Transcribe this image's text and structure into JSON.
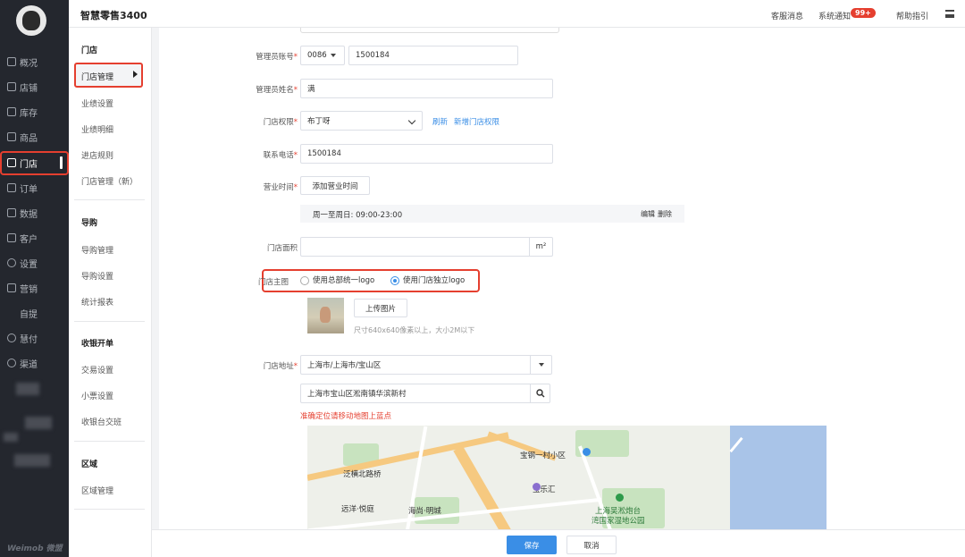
{
  "app": {
    "title": "智慧零售3400",
    "brand": "Weimob 微盟"
  },
  "topbar": {
    "service": "客服消息",
    "notify": "系统通知",
    "notify_badge": "99+",
    "help": "帮助指引"
  },
  "nav": {
    "items": [
      "概况",
      "店铺",
      "库存",
      "商品",
      "门店",
      "订单",
      "数据",
      "客户",
      "设置",
      "营销",
      "自提",
      "慧付",
      "渠道"
    ],
    "active": "门店"
  },
  "side2": {
    "group_store": "门店",
    "store_links": [
      "门店管理",
      "业绩设置",
      "业绩明细",
      "进店规则",
      "门店管理（新）"
    ],
    "group_guide": "导购",
    "guide_links": [
      "导购管理",
      "导购设置",
      "统计报表"
    ],
    "group_cashier": "收银开单",
    "cashier_links": [
      "交易设置",
      "小票设置",
      "收银台交班"
    ],
    "group_area": "区域",
    "area_links": [
      "区域管理"
    ]
  },
  "form": {
    "admin_account_label": "管理员账号",
    "country_code": "0086",
    "admin_account_value": "1500184",
    "admin_name_label": "管理员姓名",
    "admin_name_value": "满",
    "permission_label": "门店权限",
    "permission_value": "布丁呀",
    "refresh": "刷新",
    "add_permission": "新增门店权限",
    "phone_label": "联系电话",
    "phone_value": "1500184",
    "hours_label": "营业时间",
    "add_hours": "添加营业时间",
    "hours_value": "周一至周日: 09:00-23:00",
    "edit": "编辑",
    "delete": "删除",
    "area_label": "门店面积",
    "area_unit": "m²",
    "image_label": "门店主图",
    "radio_hq": "使用总部统一logo",
    "radio_own": "使用门店独立logo",
    "upload": "上传图片",
    "upload_hint": "尺寸640x640像素以上，大小2M以下",
    "address_label": "门店地址",
    "address_region": "上海市/上海市/宝山区",
    "address_detail": "上海市宝山区淞南镇华滨新村",
    "map_warning": "准确定位请移动地图上蓝点"
  },
  "map": {
    "labels": [
      "泛横北路桥",
      "宝钢一村小区",
      "宝乐汇",
      "远洋·悦庭",
      "海尚·明城",
      "上海吴淞炮台",
      "湾国家湿地公园"
    ]
  },
  "actions": {
    "save": "保存",
    "cancel": "取消"
  }
}
